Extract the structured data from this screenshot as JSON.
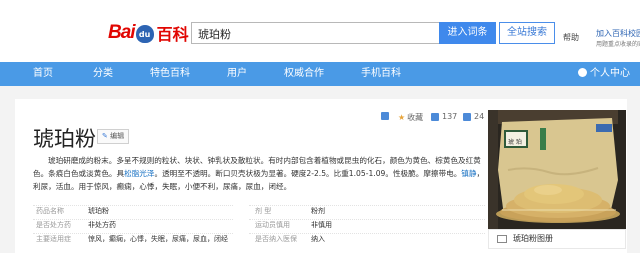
{
  "header": {
    "logo_bai": "Bai",
    "logo_du": "du",
    "logo_baike": "百科",
    "search_value": "琥珀粉",
    "search_button": "进入词条",
    "site_search_button": "全站搜索",
    "help": "帮助",
    "join": "加入百科校园",
    "join_sub": "用题重点收录的家长"
  },
  "nav": {
    "items": [
      "首页",
      "分类",
      "特色百科",
      "用户",
      "权威合作",
      "手机百科"
    ],
    "user_center": "个人中心"
  },
  "toolbar": {
    "collect": "收藏",
    "likes": "137",
    "shares": "24"
  },
  "entry": {
    "title": "琥珀粉",
    "edit_label": "编辑",
    "summary_1": "琥珀研磨成的粉末。多呈不规则的粒状、块状、钟乳状及散粒状。有时内部包含着植物或昆虫的化石，颜色为黄色、棕黄色及红黄色。条痕白色或淡黄色。具",
    "summary_link_1": "松脂光泽",
    "summary_2": "。透明至不透明。断口贝壳状极为显著。硬度2-2.5。比重1.05-1.09。性极脆。摩擦带电。",
    "summary_link_2": "镇静",
    "summary_3": "，利尿，活血。用于惊风，癫痫，心悸，失眠，小便不利，尿痛，尿血，闭经。"
  },
  "basic_info": [
    {
      "k1": "药品名称",
      "v1": "琥珀粉",
      "k2": "剂    型",
      "v2": "粉剂"
    },
    {
      "k1": "是否处方药",
      "v1": "非处方药",
      "k2": "运动员慎用",
      "v2": "非慎用"
    },
    {
      "k1": "主要适用症",
      "v1": "惊风，癫痫，心悸，失眠，尿痛，尿血，闭经",
      "k2": "是否纳入医保",
      "v2": "纳入"
    }
  ],
  "image_panel": {
    "album_label": "琥珀粉图册",
    "jar_label": "琥 珀"
  }
}
